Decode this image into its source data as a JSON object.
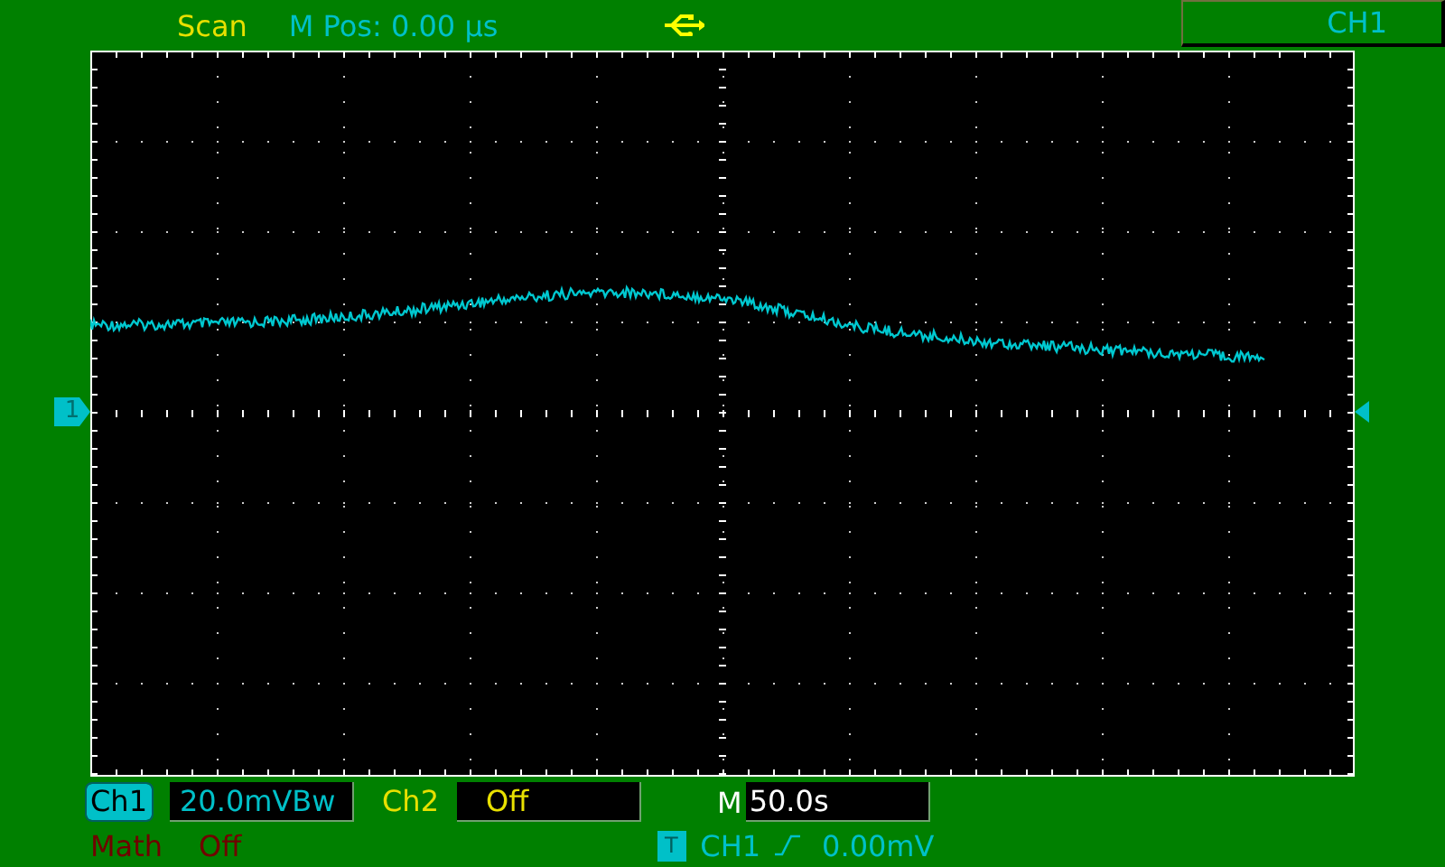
{
  "top_bar": {
    "mode": "Scan",
    "position": "M Pos: 0.00 µs",
    "channel": "CH1"
  },
  "screen": {
    "channel_marker": "1"
  },
  "bottom_bar": {
    "ch1": {
      "label": "Ch1",
      "selected": true,
      "scale": "20.0mVBw"
    },
    "ch2": {
      "label": "Ch2",
      "selected": false,
      "value": "Off"
    },
    "timebase": {
      "label": "M",
      "value": "50.0s"
    },
    "math": {
      "label": "Math",
      "value": "Off"
    },
    "trigger": {
      "marker": "T",
      "source": "CH1",
      "level": "0.00mV"
    }
  }
}
